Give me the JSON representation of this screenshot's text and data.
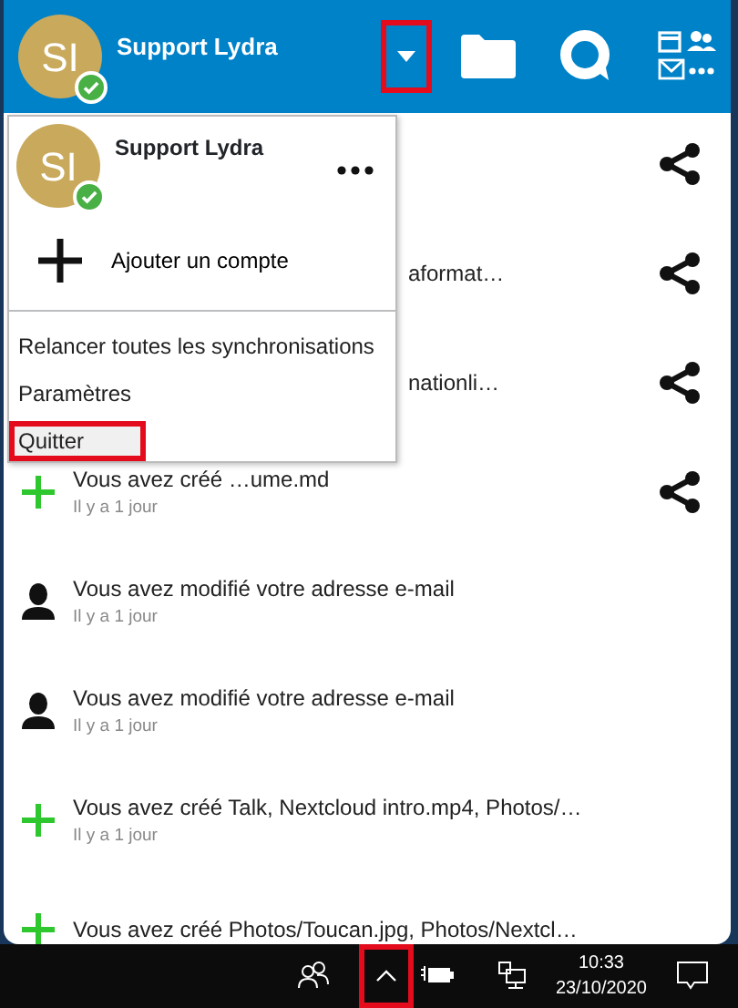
{
  "header": {
    "avatar_initials": "SI",
    "account_name": "Support Lydra",
    "online": true,
    "dropdown_annotated": true
  },
  "account_menu": {
    "open": true,
    "account": {
      "avatar_initials": "SI",
      "name": "Support Lydra",
      "online": true
    },
    "add_account": "Ajouter un compte",
    "items": [
      {
        "label": "Relancer toutes les synchronisations",
        "hovered": false,
        "annotated": false
      },
      {
        "label": "Paramètres",
        "hovered": false,
        "annotated": false
      },
      {
        "label": "Quitter",
        "hovered": true,
        "annotated": true
      }
    ]
  },
  "activities": [
    {
      "shareable": true
    },
    {
      "text": "aformat…",
      "shareable": true
    },
    {
      "text": "nationli…",
      "shareable": true
    },
    {
      "kind": "created",
      "text": "Vous avez créé …ume.md",
      "time": "Il y a 1 jour",
      "shareable": true
    },
    {
      "kind": "account",
      "text": "Vous avez modifié votre adresse e-mail",
      "time": "Il y a 1 jour",
      "shareable": false
    },
    {
      "kind": "account",
      "text": "Vous avez modifié votre adresse e-mail",
      "time": "Il y a 1 jour",
      "shareable": false
    },
    {
      "kind": "created",
      "text": "Vous avez créé Talk, Nextcloud intro.mp4, Photos/…",
      "time": "Il y a 1 jour",
      "shareable": false
    },
    {
      "kind": "created",
      "text": "Vous avez créé Photos/Toucan.jpg, Photos/Nextcl…",
      "shareable": false
    }
  ],
  "taskbar": {
    "time": "10:33",
    "date": "23/10/2020",
    "chevron_annotated": true
  }
}
